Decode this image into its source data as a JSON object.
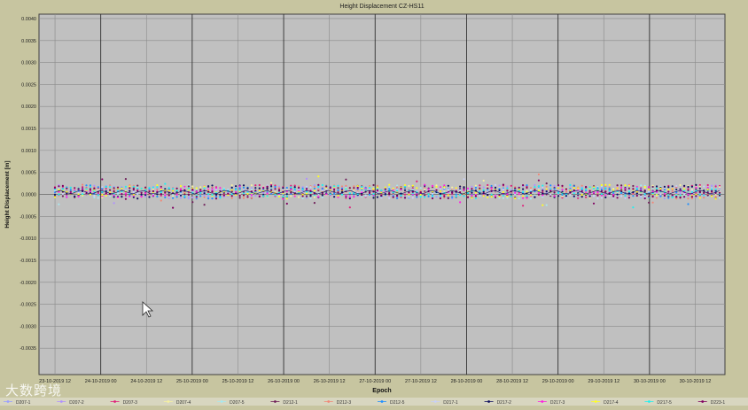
{
  "chart_data": {
    "type": "scatter",
    "title": "Height Displacement CZ-HS11",
    "xlabel": "Epoch",
    "ylabel": "Height Displacement [m]",
    "ylim": [
      -0.0041,
      0.0041
    ],
    "yticks": [
      "0.0040",
      "0.0035",
      "0.0030",
      "0.0025",
      "0.0020",
      "0.0015",
      "0.0010",
      "0.0005",
      "0.0000",
      "-0.0005",
      "-0.0010",
      "-0.0015",
      "-0.0020",
      "-0.0025",
      "-0.0030",
      "-0.0035"
    ],
    "yticks_values": [
      0.004,
      0.0035,
      0.003,
      0.0025,
      0.002,
      0.0015,
      0.001,
      0.0005,
      0,
      -0.0005,
      -0.001,
      -0.0015,
      -0.002,
      -0.0025,
      -0.003,
      -0.0035
    ],
    "xticks": [
      "23-10-2019 12",
      "24-10-2019 00",
      "24-10-2019 12",
      "25-10-2019 00",
      "25-10-2019 12",
      "26-10-2019 00",
      "26-10-2019 12",
      "27-10-2019 00",
      "27-10-2019 12",
      "28-10-2019 00",
      "28-10-2019 12",
      "29-10-2019 00",
      "29-10-2019 12",
      "30-10-2019 00",
      "30-10-2019 12"
    ],
    "grid": true,
    "legend_position": "bottom",
    "series": [
      {
        "name": "D207-1",
        "color": "#9aa0ff"
      },
      {
        "name": "D207-2",
        "color": "#b090ff"
      },
      {
        "name": "D207-3",
        "color": "#e0207a"
      },
      {
        "name": "D207-4",
        "color": "#f5f0a0"
      },
      {
        "name": "D207-5",
        "color": "#a8e8f0"
      },
      {
        "name": "D212-1",
        "color": "#70205a"
      },
      {
        "name": "D212-3",
        "color": "#f08878"
      },
      {
        "name": "D212-5",
        "color": "#2090ff"
      },
      {
        "name": "D217-1",
        "color": "#c8d0f8"
      },
      {
        "name": "D217-2",
        "color": "#101060"
      },
      {
        "name": "D217-3",
        "color": "#ff20e0"
      },
      {
        "name": "D217-4",
        "color": "#ffff20"
      },
      {
        "name": "D217-5",
        "color": "#20f0f0"
      },
      {
        "name": "D223-1",
        "color": "#800060"
      }
    ]
  },
  "watermark": "大数跨境"
}
